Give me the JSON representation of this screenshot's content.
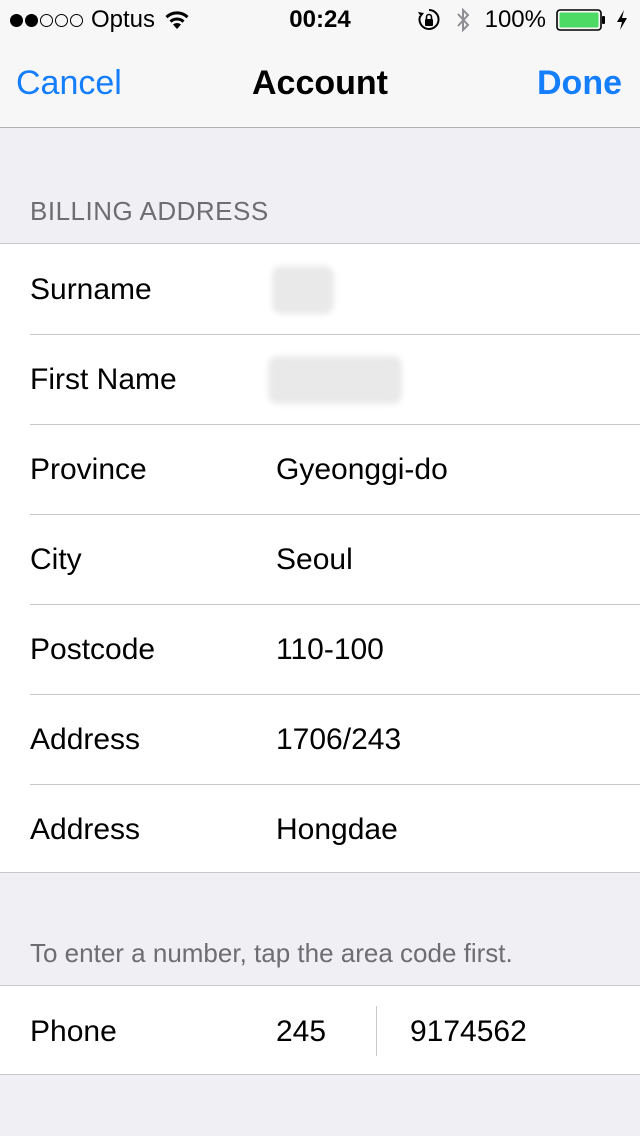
{
  "status_bar": {
    "carrier": "Optus",
    "time": "00:24",
    "battery_percent": "100%",
    "battery_level": 1.0,
    "battery_color": "#4cd964",
    "signal_bars_filled": 2,
    "signal_bars_total": 5
  },
  "nav": {
    "cancel_label": "Cancel",
    "title": "Account",
    "done_label": "Done",
    "accent_color": "#147efb"
  },
  "billing": {
    "section_title": "BILLING ADDRESS",
    "rows": [
      {
        "label": "Surname",
        "value": ""
      },
      {
        "label": "First Name",
        "value": ""
      },
      {
        "label": "Province",
        "value": "Gyeonggi-do"
      },
      {
        "label": "City",
        "value": "Seoul"
      },
      {
        "label": "Postcode",
        "value": "110-100"
      },
      {
        "label": "Address",
        "value": "1706/243"
      },
      {
        "label": "Address",
        "value": "Hongdae"
      }
    ]
  },
  "phone": {
    "hint": "To enter a number, tap the area code first.",
    "label": "Phone",
    "area_code": "245",
    "number": "9174562"
  },
  "icons": [
    "wifi-icon",
    "orientation-lock-icon",
    "bluetooth-icon",
    "battery-icon",
    "charging-icon"
  ]
}
